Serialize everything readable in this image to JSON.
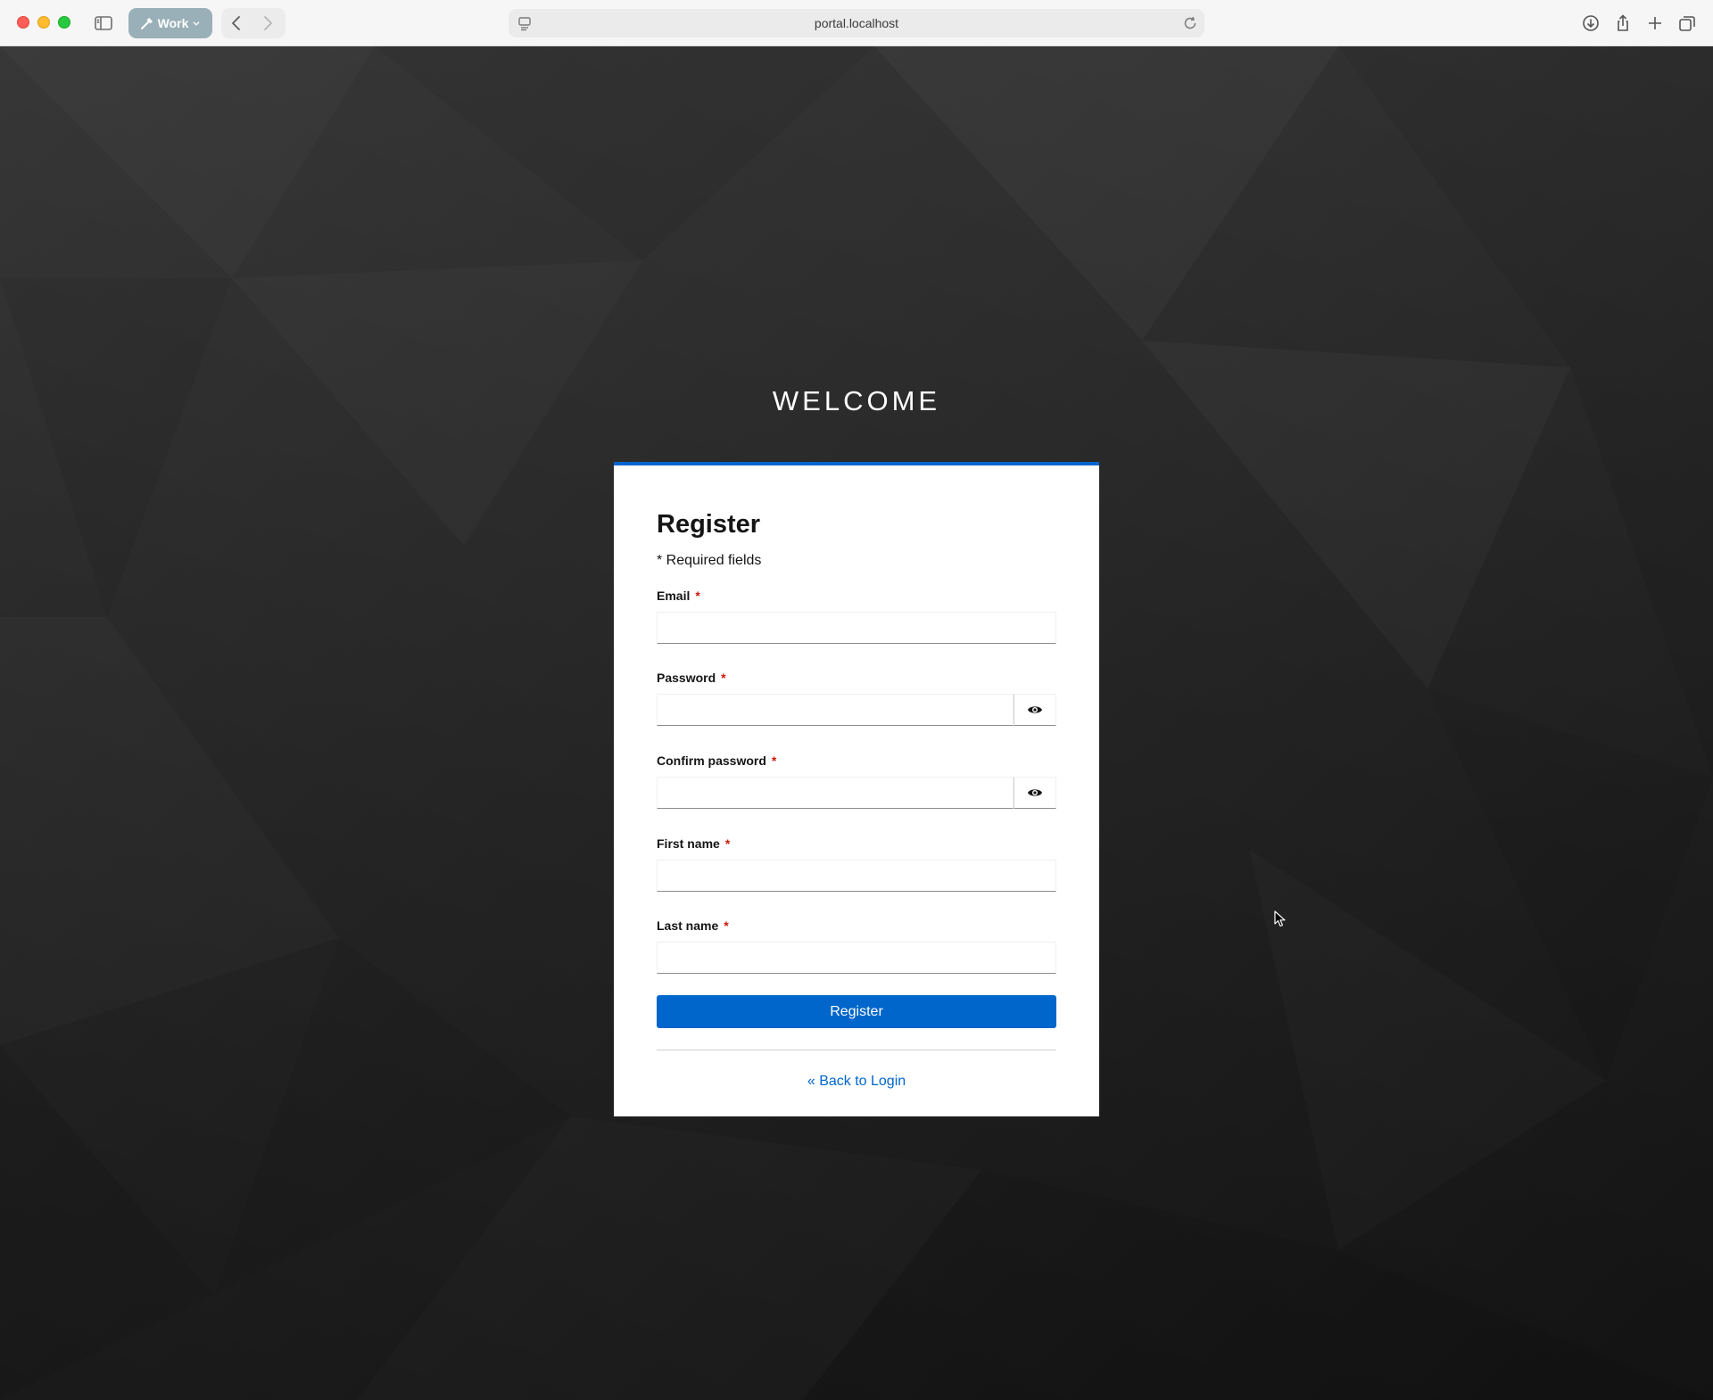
{
  "browser": {
    "profile_label": "Work",
    "url": "portal.localhost"
  },
  "page": {
    "heading": "WELCOME"
  },
  "form": {
    "title": "Register",
    "required_note": "* Required fields",
    "fields": [
      {
        "label": "Email",
        "value": "",
        "type": "email"
      },
      {
        "label": "Password",
        "value": "",
        "type": "password"
      },
      {
        "label": "Confirm password",
        "value": "",
        "type": "password"
      },
      {
        "label": "First name",
        "value": "",
        "type": "text"
      },
      {
        "label": "Last name",
        "value": "",
        "type": "text"
      }
    ],
    "required_marker": "*",
    "submit_label": "Register",
    "back_link": "« Back to Login"
  },
  "colors": {
    "accent": "#0066cc",
    "required": "#c9190b"
  }
}
